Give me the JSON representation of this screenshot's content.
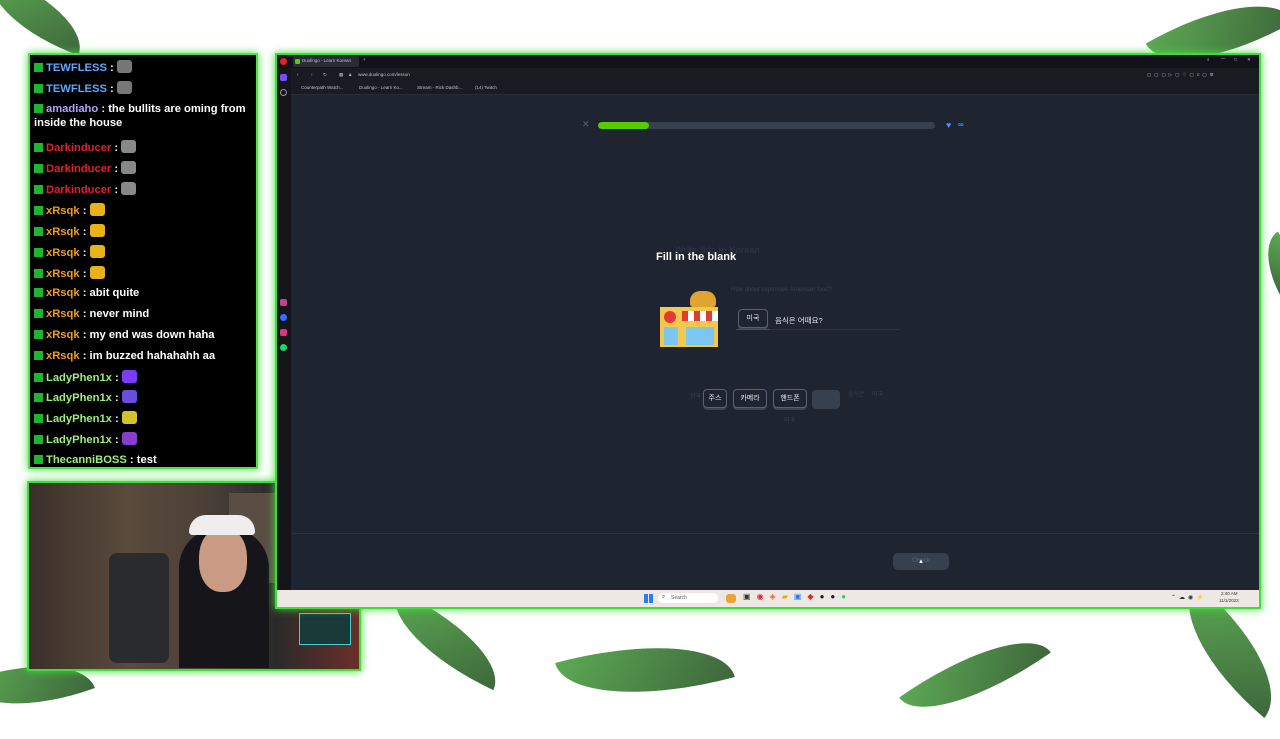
{
  "chat": {
    "messages": [
      {
        "user": "TEWFLESS",
        "sep": " : ",
        "text": "",
        "color": "#5da9ff",
        "emote": "#777"
      },
      {
        "user": "TEWFLESS",
        "sep": " : ",
        "text": "",
        "color": "#5da9ff",
        "emote": "#777"
      },
      {
        "user": "amadiaho",
        "sep": " : ",
        "text": "the bullits are oming from inside the house",
        "color": "#b0a2ff",
        "emote": ""
      },
      {
        "user": "Darkinducer",
        "sep": " : ",
        "text": "",
        "color": "#e2222b",
        "emote": "#888"
      },
      {
        "user": "Darkinducer",
        "sep": " : ",
        "text": "",
        "color": "#e2222b",
        "emote": "#888"
      },
      {
        "user": "Darkinducer",
        "sep": " : ",
        "text": "",
        "color": "#e2222b",
        "emote": "#888"
      },
      {
        "user": "xRsqk",
        "sep": " : ",
        "text": "",
        "color": "#f29c1f",
        "emote": "#e8b21a"
      },
      {
        "user": "xRsqk",
        "sep": " : ",
        "text": "",
        "color": "#f29c1f",
        "emote": "#e8b21a"
      },
      {
        "user": "xRsqk",
        "sep": " : ",
        "text": "",
        "color": "#f29c1f",
        "emote": "#e8b21a"
      },
      {
        "user": "xRsqk",
        "sep": " : ",
        "text": "",
        "color": "#f29c1f",
        "emote": "#e8b21a"
      },
      {
        "user": "xRsqk",
        "sep": " : ",
        "text": "abit quite",
        "color": "#f29c1f",
        "emote": ""
      },
      {
        "user": "xRsqk",
        "sep": " : ",
        "text": "never mind",
        "color": "#f29c1f",
        "emote": ""
      },
      {
        "user": "xRsqk",
        "sep": " : ",
        "text": "my end was down haha",
        "color": "#f29c1f",
        "emote": ""
      },
      {
        "user": "xRsqk",
        "sep": " : ",
        "text": "im buzzed hahahahh aa",
        "color": "#f29c1f",
        "emote": ""
      },
      {
        "user": "LadyPhen1x",
        "sep": " : ",
        "text": "",
        "color": "#9bf07a",
        "emote": "#7a3cff"
      },
      {
        "user": "LadyPhen1x",
        "sep": " : ",
        "text": "",
        "color": "#9bf07a",
        "emote": "#6a4ce0"
      },
      {
        "user": "LadyPhen1x",
        "sep": " : ",
        "text": "",
        "color": "#9bf07a",
        "emote": "#d4c22a"
      },
      {
        "user": "LadyPhen1x",
        "sep": " : ",
        "text": "",
        "color": "#9bf07a",
        "emote": "#8a3ccc"
      },
      {
        "user": "ThecanniBOSS",
        "sep": " : ",
        "text": "test",
        "color": "#9bf07a",
        "emote": ""
      }
    ]
  },
  "browser": {
    "tab_title": "Duolingo - Learn Korean",
    "url": "www.duolingo.com/lesson",
    "bookmarks": [
      "Counterpath Watch...",
      "Duolingo - Learn Ko...",
      "Stream - Rick Dashb...",
      "(14) Twitch"
    ]
  },
  "lesson": {
    "progress": 0.15,
    "hearts": "∞",
    "ghost_title": "Write this in Korean",
    "title": "Fill in the blank",
    "ghost_prompt": "How about expensive American food?",
    "filled_word": "미국",
    "sentence_rest": "음식은 어때요?",
    "word_bank": [
      "주스",
      "카메라",
      "핸드폰",
      ""
    ],
    "ghost_words": [
      "한국",
      "미국",
      "음식은"
    ],
    "ghost_word_below": "미국",
    "check_label": "Check"
  },
  "taskbar": {
    "search_placeholder": "Search",
    "time": "2:40 AM",
    "date": "11/1/2023"
  }
}
